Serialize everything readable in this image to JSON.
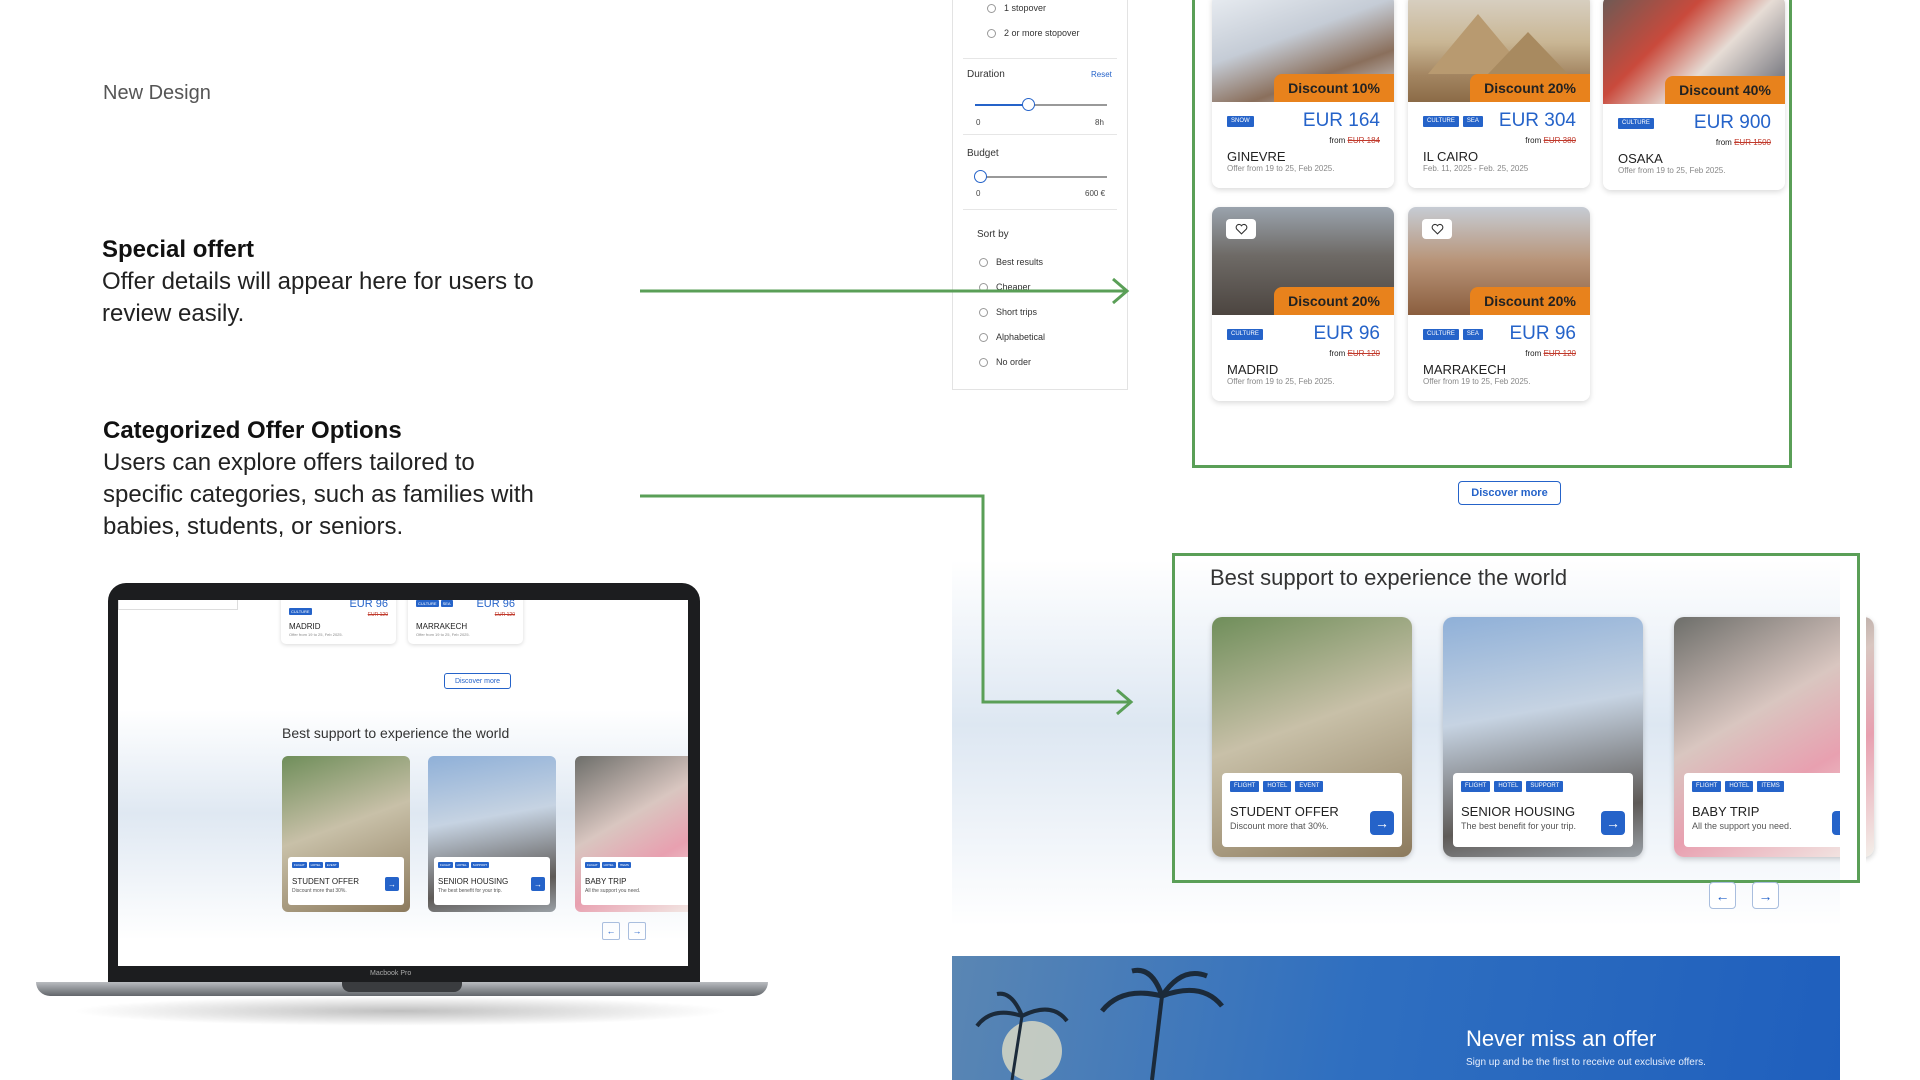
{
  "header": {
    "label": "New Design"
  },
  "annotations": [
    {
      "title": "Special offert",
      "body": "Offer details will appear here for users to review easily."
    },
    {
      "title": "Categorized Offer Options",
      "body": "Users can explore offers tailored to specific categories, such as families with babies, students, or seniors."
    }
  ],
  "filters": {
    "stopovers": [
      "1 stopover",
      "2 or more stopover"
    ],
    "duration": {
      "label": "Duration",
      "reset": "Reset",
      "min": "0",
      "max": "8h",
      "value_fraction": 0.4
    },
    "budget": {
      "label": "Budget",
      "min": "0",
      "max": "600 €",
      "value_fraction": 0.0
    },
    "sort": {
      "label": "Sort by",
      "options": [
        "Best results",
        "Cheaper",
        "Short trips",
        "Alphabetical",
        "No order"
      ]
    }
  },
  "offers": [
    {
      "discount": "Discount 10%",
      "tags": [
        "SNOW"
      ],
      "price": "EUR 164",
      "from_label": "from",
      "old_price": "EUR 184",
      "city": "GINEVRE",
      "dates": "Offer from 19 to 25, Feb 2025.",
      "favorite": false
    },
    {
      "discount": "Discount 20%",
      "tags": [
        "CULTURE",
        "SEA"
      ],
      "price": "EUR 304",
      "from_label": "from",
      "old_price": "EUR 380",
      "city": "IL CAIRO",
      "dates": "Feb. 11, 2025 - Feb. 25, 2025",
      "favorite": false
    },
    {
      "discount": "Discount 40%",
      "tags": [
        "CULTURE"
      ],
      "price": "EUR 900",
      "from_label": "from",
      "old_price": "EUR 1500",
      "city": "OSAKA",
      "dates": "Offer from 19 to 25, Feb 2025.",
      "favorite": false
    },
    {
      "discount": "Discount 20%",
      "tags": [
        "CULTURE"
      ],
      "price": "EUR 96",
      "from_label": "from",
      "old_price": "EUR 120",
      "city": "MADRID",
      "dates": "Offer from 19 to 25, Feb 2025.",
      "favorite": true
    },
    {
      "discount": "Discount 20%",
      "tags": [
        "CULTURE",
        "SEA"
      ],
      "price": "EUR 96",
      "from_label": "from",
      "old_price": "EUR 120",
      "city": "MARRAKECH",
      "dates": "Offer from 19 to 25, Feb 2025.",
      "favorite": true
    }
  ],
  "discover_more": "Discover more",
  "support": {
    "title": "Best support to experience the world",
    "cards": [
      {
        "tags": [
          "FLIGHT",
          "HOTEL",
          "EVENT"
        ],
        "title": "STUDENT OFFER",
        "subtitle": "Discount more that 30%."
      },
      {
        "tags": [
          "FLIGHT",
          "HOTEL",
          "SUPPORT"
        ],
        "title": "SENIOR HOUSING",
        "subtitle": "The best benefit for your trip."
      },
      {
        "tags": [
          "FLIGHT",
          "HOTEL",
          "ITEMS"
        ],
        "title": "BABY TRIP",
        "subtitle": "All the support you need."
      }
    ],
    "prev": "←",
    "next": "→"
  },
  "newsletter": {
    "title": "Never miss an offer",
    "subtitle": "Sign up and be the first to receive out exclusive offers."
  },
  "laptop": {
    "label": "Macbook Pro",
    "mini_offers": [
      {
        "price": "EUR 96",
        "old_price": "EUR 120",
        "city": "MADRID",
        "dates": "Offer from 19 to 25, Feb 2025.",
        "tags": [
          "CULTURE"
        ]
      },
      {
        "price": "EUR 96",
        "old_price": "EUR 120",
        "city": "MARRAKECH",
        "dates": "Offer from 19 to 25, Feb 2025.",
        "tags": [
          "CULTURE",
          "SEA"
        ]
      }
    ],
    "discover_more": "Discover more",
    "support_title": "Best support to experience the world",
    "cards": [
      {
        "tags": [
          "FLIGHT",
          "HOTEL",
          "EVENT"
        ],
        "title": "STUDENT OFFER",
        "subtitle": "Discount more that 30%."
      },
      {
        "tags": [
          "FLIGHT",
          "HOTEL",
          "SUPPORT"
        ],
        "title": "SENIOR HOUSING",
        "subtitle": "The best benefit for your trip."
      },
      {
        "tags": [
          "FLIGHT",
          "HOTEL",
          "ITEMS"
        ],
        "title": "BABY TRIP",
        "subtitle": "All the support you need."
      }
    ],
    "prev": "←",
    "next": "→"
  },
  "colors": {
    "accent": "#2563c9",
    "discount": "#e8821c",
    "annotation_line": "#5a9f57",
    "old_price": "#c0392b"
  }
}
